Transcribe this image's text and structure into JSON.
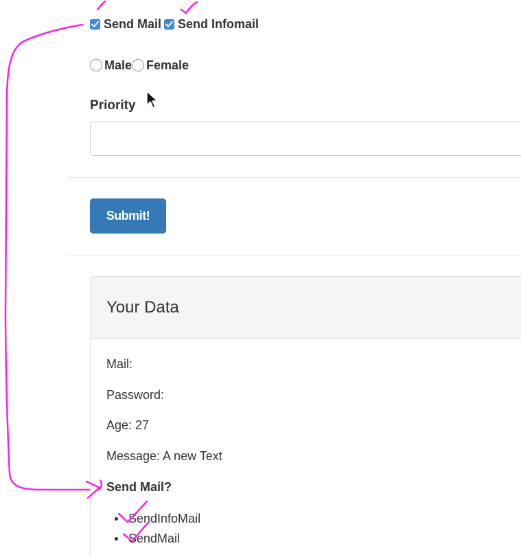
{
  "options": {
    "checkboxes": [
      {
        "label": "Send Mail",
        "checked": true
      },
      {
        "label": "Send Infomail",
        "checked": true
      }
    ],
    "radios": [
      {
        "label": "Male",
        "selected": false
      },
      {
        "label": "Female",
        "selected": false
      }
    ]
  },
  "priority": {
    "label": "Priority",
    "value": ""
  },
  "submit": {
    "label": "Submit!"
  },
  "panel": {
    "title": "Your Data",
    "mail": "Mail:",
    "password": "Password:",
    "age": "Age: 27",
    "message": "Message: A new Text",
    "send_mail_heading": "Send Mail?",
    "send_items": [
      "SendInfoMail",
      "SendMail"
    ]
  },
  "colors": {
    "primary_button": "#337ab7",
    "checkbox_accent": "#3b8de0",
    "annotation_ink": "#ff1ee8"
  },
  "icons": {
    "checkbox": "checkmark-icon",
    "cursor": "mouse-pointer-icon"
  }
}
